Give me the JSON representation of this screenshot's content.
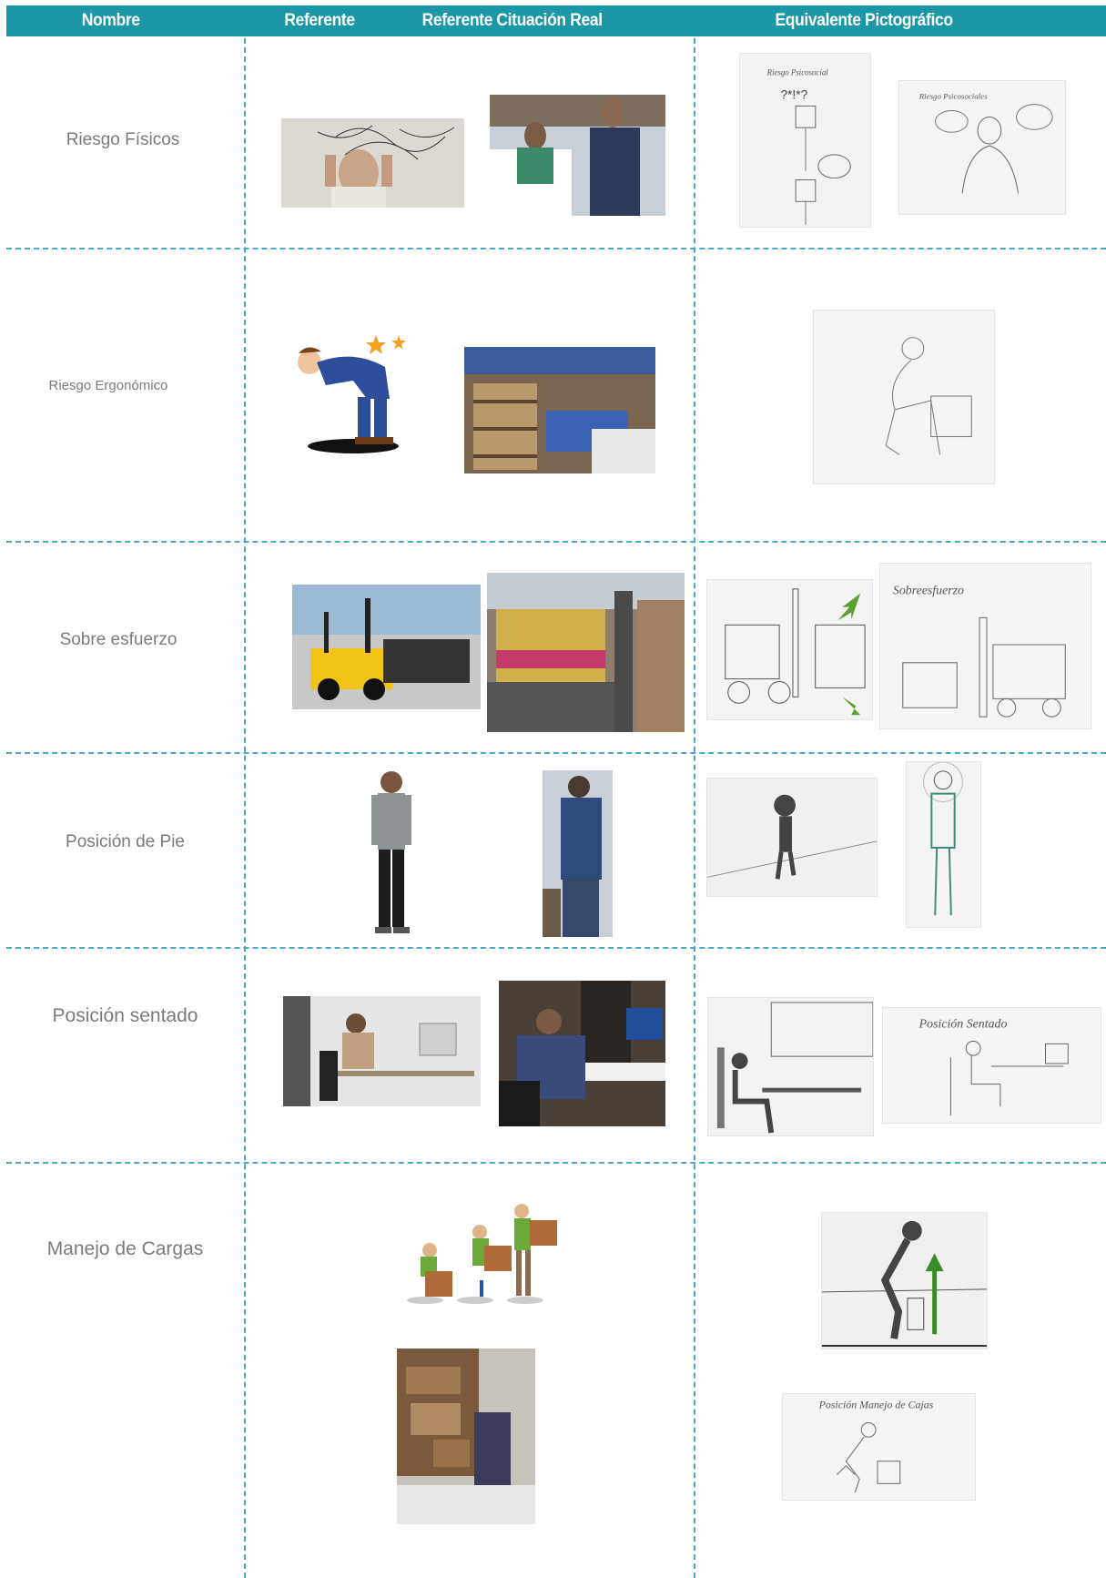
{
  "header": {
    "col_nombre": "Nombre",
    "col_referente": "Referente",
    "col_referente_real": "Referente Cituación Real",
    "col_equivalente": "Equivalente Pictográfico"
  },
  "rows": [
    {
      "name": "Riesgo Físicos"
    },
    {
      "name": "Riesgo Ergonómico"
    },
    {
      "name": "Sobre esfuerzo"
    },
    {
      "name": "Posición de Pie"
    },
    {
      "name": "Posición sentado"
    },
    {
      "name": "Manejo de Cargas"
    }
  ],
  "sketch_labels": {
    "riesgo_psicosocial_1": "Riesgo Psicosocial",
    "riesgo_psicosocial_2": "Riesgo Psicosociales",
    "sobre_esfuerzo": "Sobreesfuerzo",
    "posicion_sentado": "Posición Sentado",
    "manejo_cajas": "Posición Manejo de Cajas"
  },
  "colors": {
    "header_bg": "#1c97a8",
    "header_text": "#ffffff",
    "divider": "#49a9c4",
    "row_label": "#7b7b7b"
  }
}
